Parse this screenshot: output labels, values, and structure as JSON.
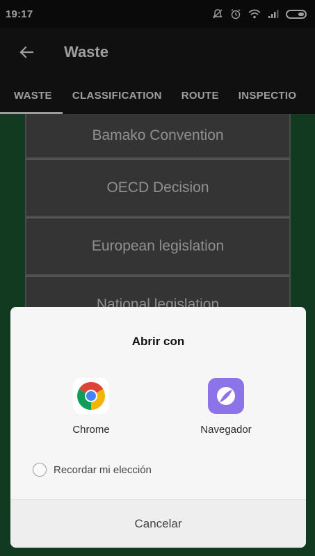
{
  "status_bar": {
    "time": "19:17",
    "icons": [
      "notifications-off-icon",
      "alarm-icon",
      "wifi-icon",
      "signal-icon",
      "battery-icon"
    ]
  },
  "app_bar": {
    "back_icon": "arrow-left-icon",
    "title": "Waste"
  },
  "tabs": [
    {
      "label": "WASTE",
      "active": true
    },
    {
      "label": "CLASSIFICATION",
      "active": false
    },
    {
      "label": "ROUTE",
      "active": false
    },
    {
      "label": "INSPECTIO",
      "active": false
    }
  ],
  "cards": [
    {
      "label": "Bamako Convention"
    },
    {
      "label": "OECD Decision"
    },
    {
      "label": "European legislation"
    },
    {
      "label": "National legislation"
    }
  ],
  "dialog": {
    "title": "Abrir con",
    "apps": [
      {
        "label": "Chrome",
        "icon": "chrome-icon"
      },
      {
        "label": "Navegador",
        "icon": "browser-icon"
      }
    ],
    "remember_label": "Recordar mi elección",
    "remember_checked": false,
    "cancel_label": "Cancelar"
  },
  "colors": {
    "content_background": "#1d5e35",
    "card_background": "#555555",
    "browser_icon": "#8c73e8"
  }
}
